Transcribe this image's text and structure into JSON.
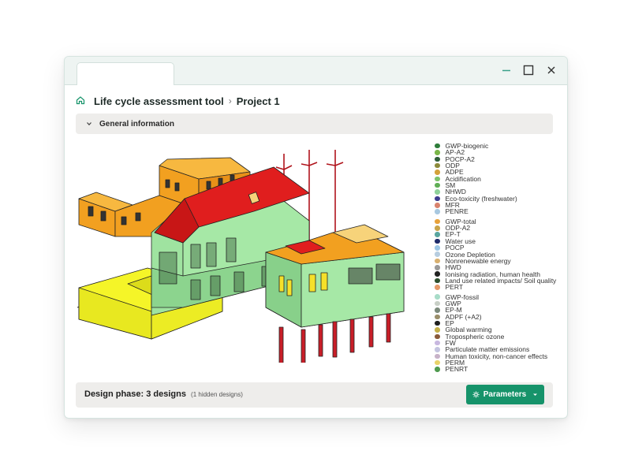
{
  "breadcrumb": {
    "title": "Life cycle assessment tool",
    "separator": "›",
    "project": "Project 1"
  },
  "section": {
    "label": "General information"
  },
  "legend": {
    "groups": [
      [
        {
          "label": "GWP-biogenic",
          "color": "#2e7d3a"
        },
        {
          "label": "AP-A2",
          "color": "#7ab648"
        },
        {
          "label": "POCP-A2",
          "color": "#2f5e3a"
        },
        {
          "label": "ODP",
          "color": "#8c8a3a"
        },
        {
          "label": "ADPE",
          "color": "#d4a23a"
        },
        {
          "label": "Acidification",
          "color": "#7cc26b"
        },
        {
          "label": "SM",
          "color": "#5fae55"
        },
        {
          "label": "NHWD",
          "color": "#8fd19a"
        },
        {
          "label": "Eco-toxicity (freshwater)",
          "color": "#3d3c8f"
        },
        {
          "label": "MFR",
          "color": "#d9836e"
        },
        {
          "label": "PENRE",
          "color": "#a8c8e0"
        }
      ],
      [
        {
          "label": "GWP-total",
          "color": "#e8a23a"
        },
        {
          "label": "ODP-A2",
          "color": "#c9a44a"
        },
        {
          "label": "EP-T",
          "color": "#5aa6a0"
        },
        {
          "label": "Water use",
          "color": "#1e2b6a"
        },
        {
          "label": "POCP",
          "color": "#9cc6e6"
        },
        {
          "label": "Ozone Depletion",
          "color": "#b7cde0"
        },
        {
          "label": "Nonrenewable energy",
          "color": "#d8b070"
        },
        {
          "label": "HWD",
          "color": "#9a9a9a"
        },
        {
          "label": "Ionising radiation, human health",
          "color": "#222222"
        },
        {
          "label": "Land use related impacts/ Soil quality",
          "color": "#2e4f2e"
        },
        {
          "label": "PERT",
          "color": "#e59a6a"
        }
      ],
      [
        {
          "label": "GWP-fossil",
          "color": "#a8dcc8"
        },
        {
          "label": "GWP",
          "color": "#c8cfc6"
        },
        {
          "label": "EP-M",
          "color": "#7c8a7c"
        },
        {
          "label": "ADPF (+A2)",
          "color": "#9a8e6a"
        },
        {
          "label": "EP",
          "color": "#1f1f1f"
        },
        {
          "label": "Global warming",
          "color": "#c4b04a"
        },
        {
          "label": "Tropospheric ozone",
          "color": "#8a5a3a"
        },
        {
          "label": "FW",
          "color": "#c8b8e0"
        },
        {
          "label": "Particulate matter emissions",
          "color": "#c4c4e0"
        },
        {
          "label": "Human toxicity, non-cancer effects",
          "color": "#c7b2c8"
        },
        {
          "label": "PERM",
          "color": "#e8d36a"
        },
        {
          "label": "PENRT",
          "color": "#4f9a4f"
        }
      ]
    ]
  },
  "footer": {
    "design_phase": "Design phase: 3 designs",
    "hidden_note": "(1 hidden designs)",
    "parameters_label": "Parameters"
  },
  "colors": {
    "accent": "#16936a",
    "roof": "#e01e1e",
    "walls_green": "#9fe3a0",
    "slab_yellow": "#f5f528",
    "wing_orange": "#f2a020",
    "columns": "#c81e28"
  },
  "icons": {
    "home": "home-icon",
    "chevron": "chevron-down-icon",
    "gear": "gear-icon",
    "caret": "caret-down-icon",
    "minimize": "minimize-icon",
    "maximize": "maximize-icon",
    "close": "close-icon"
  }
}
